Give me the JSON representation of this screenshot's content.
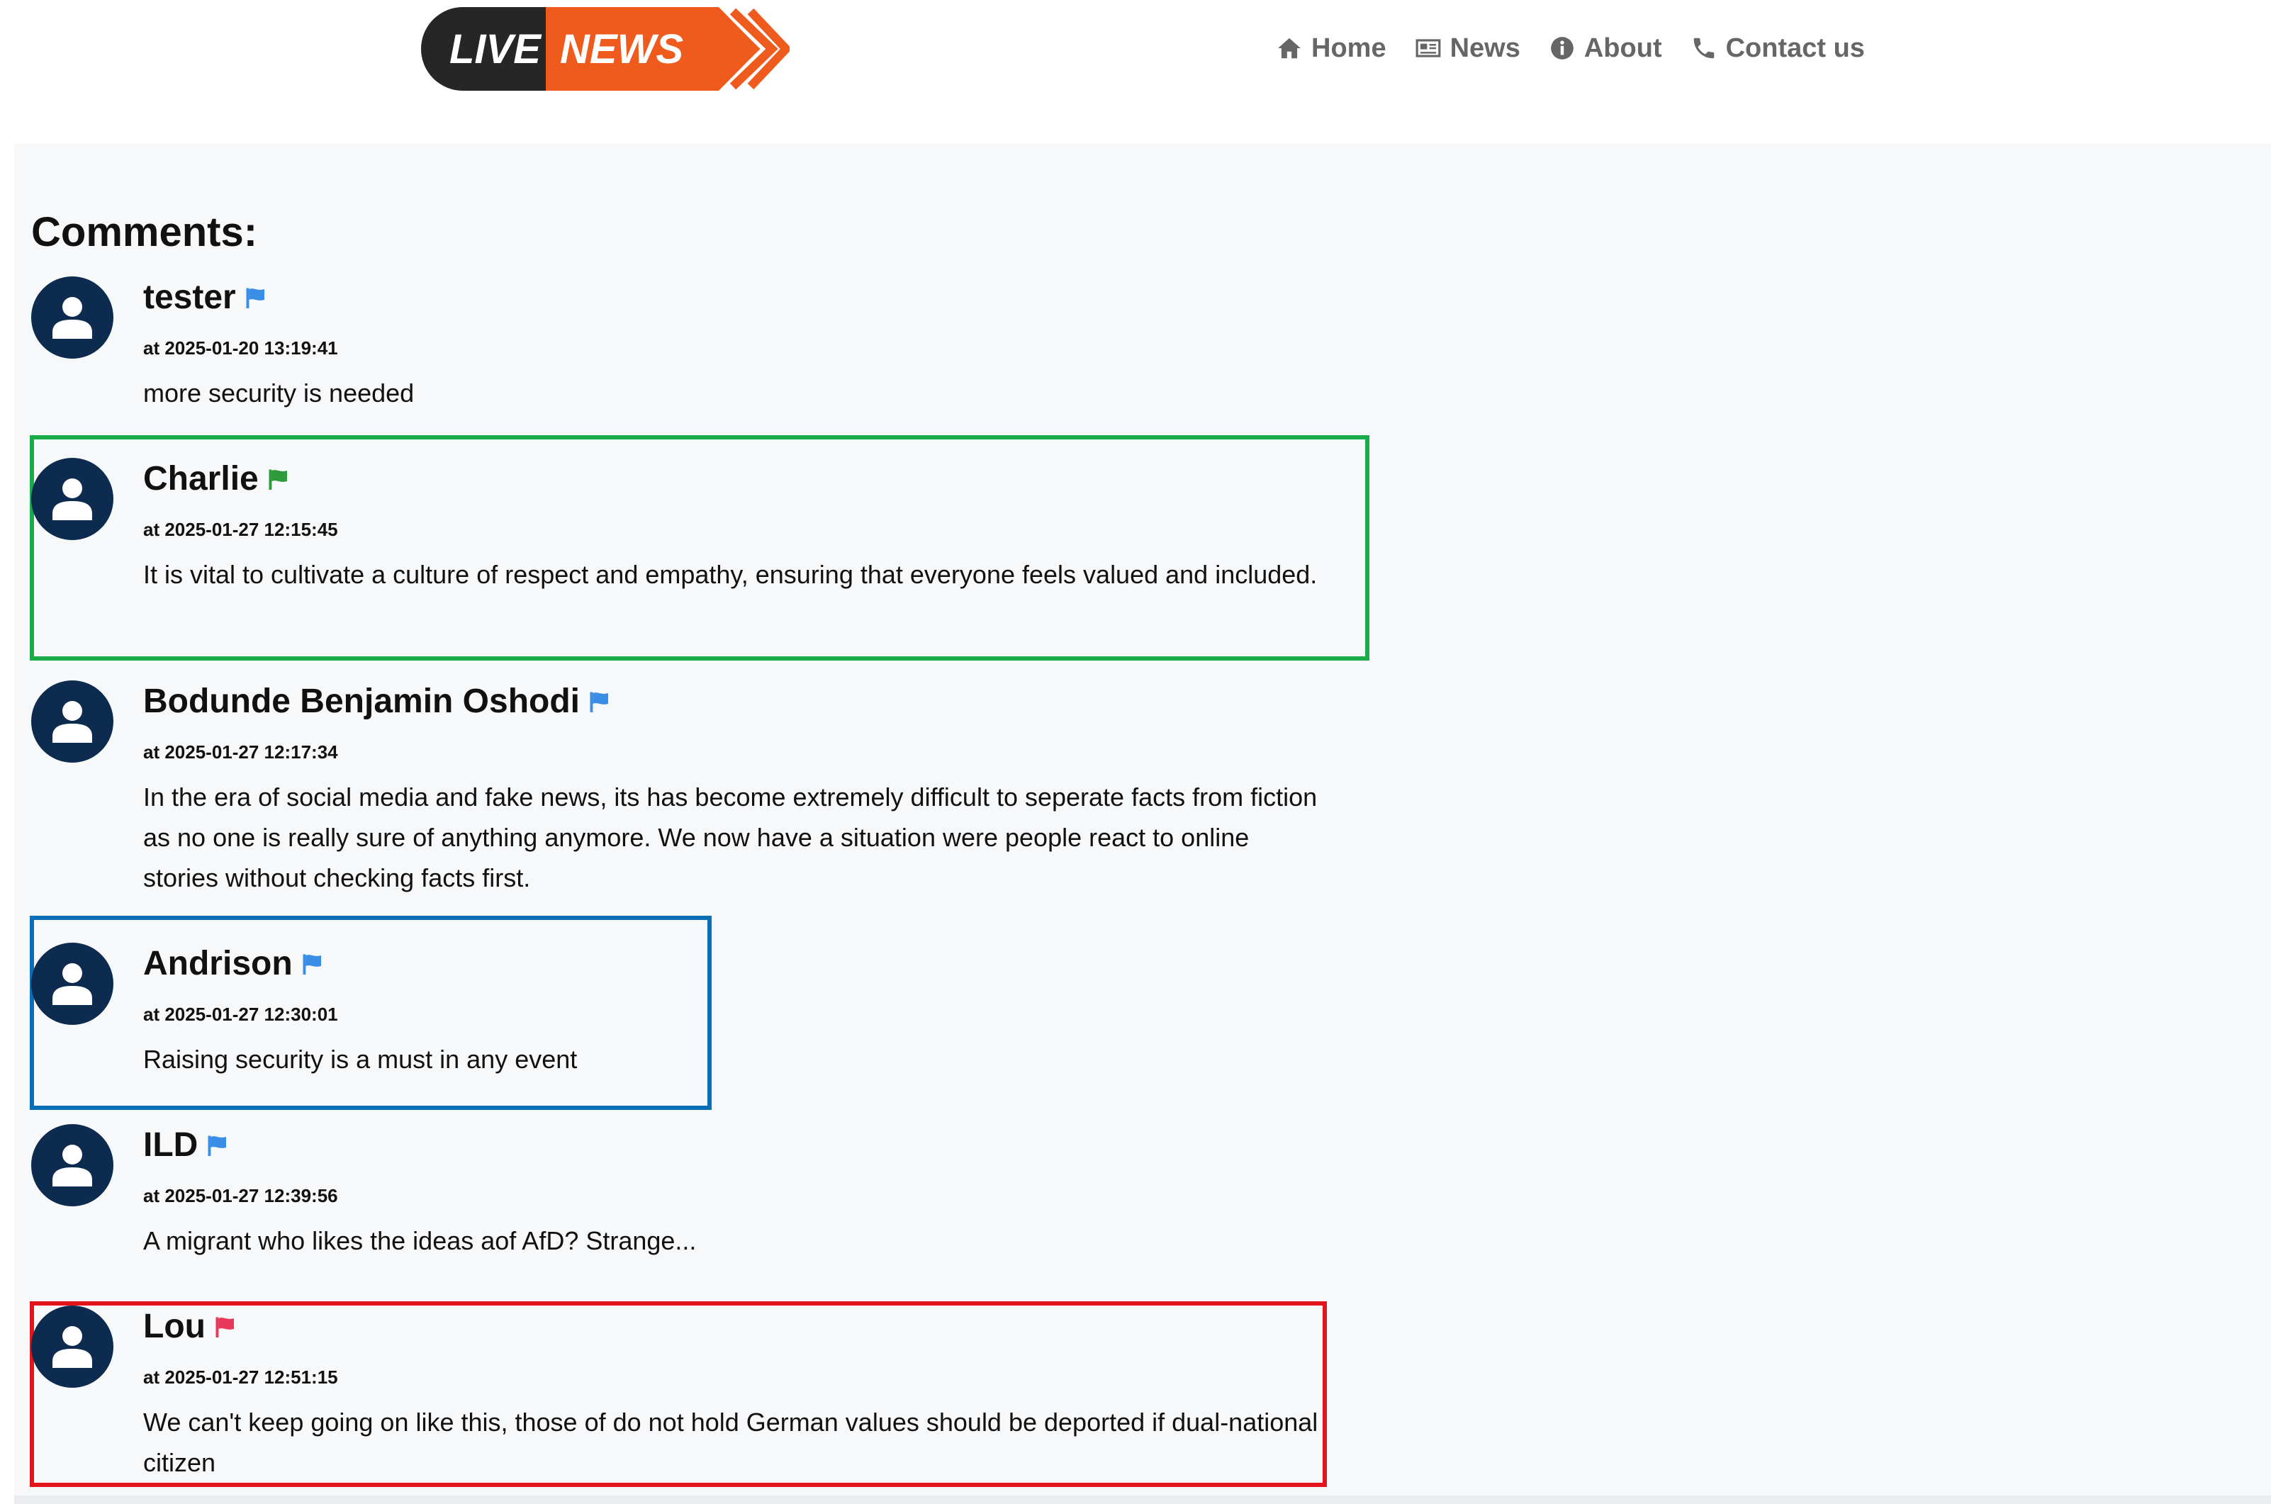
{
  "logo": {
    "text_live": "LIVE",
    "text_news": "NEWS"
  },
  "nav": [
    {
      "label": "Home",
      "icon": "home-icon"
    },
    {
      "label": "News",
      "icon": "newspaper-icon"
    },
    {
      "label": "About",
      "icon": "info-icon"
    },
    {
      "label": "Contact us",
      "icon": "phone-icon"
    }
  ],
  "comments_section": {
    "title": "Comments:"
  },
  "comments": [
    {
      "author": "tester",
      "timestamp": "at 2025-01-20 13:19:41",
      "text": "more security is needed",
      "flag_color": "#3a8ee6",
      "highlight": ""
    },
    {
      "author": "Charlie",
      "timestamp": "at 2025-01-27 12:15:45",
      "text": "It is vital to cultivate a culture of respect and empathy, ensuring that everyone feels valued and included.",
      "flag_color": "#2e9a3b",
      "highlight": "#1aab4a"
    },
    {
      "author": "Bodunde Benjamin Oshodi",
      "timestamp": "at 2025-01-27 12:17:34",
      "text": "In the era of social media and fake news, its has become extremely difficult to seperate facts from fiction as no one is really sure of anything anymore. We now have a situation were people react to online stories without checking facts first.",
      "flag_color": "#3a8ee6",
      "highlight": ""
    },
    {
      "author": "Andrison",
      "timestamp": "at 2025-01-27 12:30:01",
      "text": "Raising security is a must in any event",
      "flag_color": "#3a8ee6",
      "highlight": "#0b6fb8"
    },
    {
      "author": "ILD",
      "timestamp": "at 2025-01-27 12:39:56",
      "text": "A migrant who likes the ideas aof AfD? Strange...",
      "flag_color": "#3a8ee6",
      "highlight": ""
    },
    {
      "author": "Lou",
      "timestamp": "at 2025-01-27 12:51:15",
      "text": "We can't keep going on like this, those of do not hold German values should be deported if dual-national citizen",
      "flag_color": "#e8395a",
      "highlight": "#e3141b"
    }
  ],
  "colors": {
    "avatar": "#0d2b4e",
    "nav_text": "#666666",
    "panel_bg": "#f7f8fa"
  }
}
